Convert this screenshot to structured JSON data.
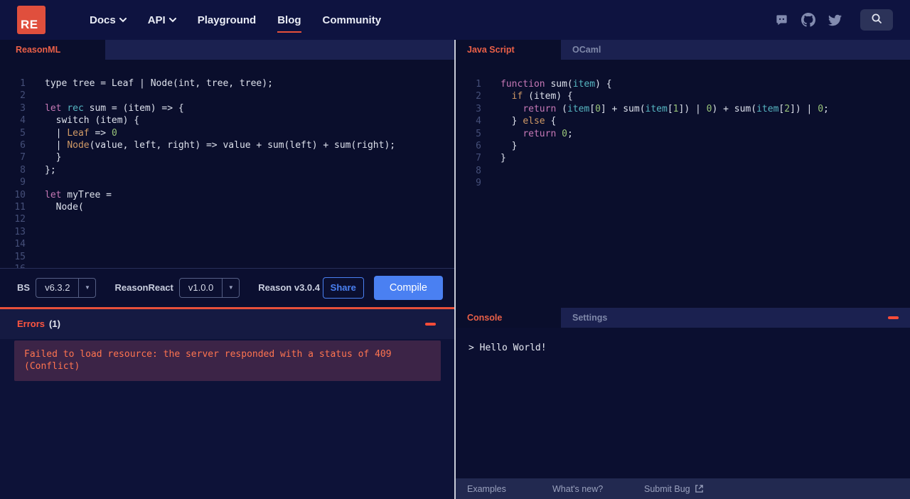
{
  "brand": {
    "logo": "RE"
  },
  "nav": {
    "items": [
      {
        "label": "Docs"
      },
      {
        "label": "API"
      },
      {
        "label": "Playground"
      },
      {
        "label": "Blog"
      },
      {
        "label": "Community"
      }
    ]
  },
  "colors": {
    "accent": "#e8503a",
    "blue": "#4a80f2",
    "error_text": "#ff7450",
    "error_bg": "#3c2447"
  },
  "left_editor": {
    "tab": "ReasonML",
    "lines": [
      [
        [
          "d",
          "type tree = Leaf | Node(int, tree, tree);"
        ]
      ],
      [],
      [
        [
          "k",
          "let"
        ],
        [
          "d",
          " "
        ],
        [
          "c",
          "rec"
        ],
        [
          "d",
          " sum = (item) => {"
        ]
      ],
      [
        [
          "d",
          "  switch (item) {"
        ]
      ],
      [
        [
          "d",
          "  | "
        ],
        [
          "o",
          "Leaf"
        ],
        [
          "d",
          " => "
        ],
        [
          "g",
          "0"
        ]
      ],
      [
        [
          "d",
          "  | "
        ],
        [
          "o",
          "Node"
        ],
        [
          "d",
          "(value, left, right) => value + sum(left) + sum(right);"
        ]
      ],
      [
        [
          "d",
          "  }"
        ]
      ],
      [
        [
          "d",
          "};"
        ]
      ],
      [],
      [
        [
          "k",
          "let"
        ],
        [
          "d",
          " myTree ="
        ]
      ],
      [
        [
          "d",
          "  Node("
        ]
      ],
      [],
      [],
      [],
      [],
      [],
      [],
      []
    ]
  },
  "right_editor": {
    "tab_js": "Java Script",
    "tab_ocaml": "OCaml",
    "lines": [
      [
        [
          "k",
          "function"
        ],
        [
          "d",
          " sum("
        ],
        [
          "c",
          "item"
        ],
        [
          "d",
          ") {"
        ]
      ],
      [
        [
          "d",
          "  "
        ],
        [
          "o",
          "if"
        ],
        [
          "d",
          " (item) {"
        ]
      ],
      [
        [
          "d",
          "    "
        ],
        [
          "k",
          "return"
        ],
        [
          "d",
          " ("
        ],
        [
          "c",
          "item"
        ],
        [
          "d",
          "["
        ],
        [
          "g",
          "0"
        ],
        [
          "d",
          "] + sum("
        ],
        [
          "c",
          "item"
        ],
        [
          "d",
          "["
        ],
        [
          "g",
          "1"
        ],
        [
          "d",
          "]) | "
        ],
        [
          "g",
          "0"
        ],
        [
          "d",
          ") + sum("
        ],
        [
          "c",
          "item"
        ],
        [
          "d",
          "["
        ],
        [
          "g",
          "2"
        ],
        [
          "d",
          "]) | "
        ],
        [
          "g",
          "0"
        ],
        [
          "d",
          ";"
        ]
      ],
      [
        [
          "d",
          "  } "
        ],
        [
          "o",
          "else"
        ],
        [
          "d",
          " {"
        ]
      ],
      [
        [
          "d",
          "    "
        ],
        [
          "k",
          "return"
        ],
        [
          "d",
          " "
        ],
        [
          "g",
          "0"
        ],
        [
          "d",
          ";"
        ]
      ],
      [
        [
          "d",
          "  }"
        ]
      ],
      [
        [
          "d",
          "}"
        ]
      ],
      [],
      []
    ]
  },
  "console": {
    "tab_console": "Console",
    "tab_settings": "Settings",
    "output": "> Hello World!"
  },
  "toolbar": {
    "bs_label": "BS",
    "bs_version": "v6.3.2",
    "reasonreact_label": "ReasonReact",
    "reasonreact_version": "v1.0.0",
    "reason_version": "Reason v3.0.4",
    "share": "Share",
    "compile": "Compile"
  },
  "errors": {
    "title": "Errors",
    "count": "(1)",
    "message": "Failed to load resource: the server responded with a status of 409 (Conflict)"
  },
  "footer": {
    "examples": "Examples",
    "whats_new": "What's new?",
    "submit_bug": "Submit Bug"
  }
}
